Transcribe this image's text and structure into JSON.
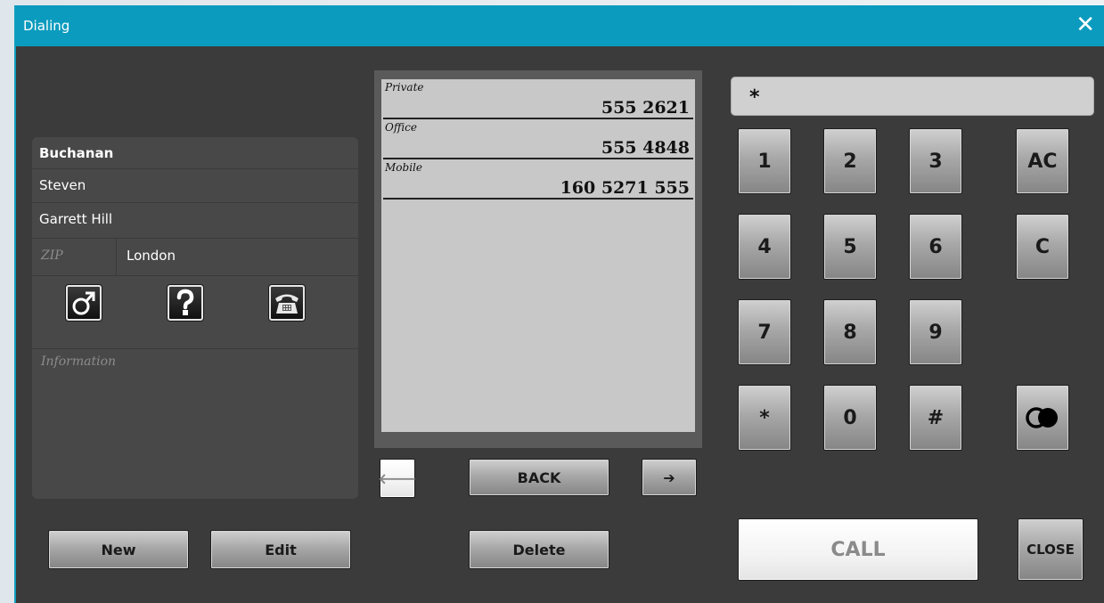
{
  "window": {
    "title": "Dialing",
    "close_glyph": "✕"
  },
  "contact": {
    "last_name": "Buchanan",
    "first_name": "Steven",
    "street": "Garrett Hill",
    "zip_placeholder": "ZIP",
    "city": "London",
    "info_placeholder": "Information",
    "icons": [
      "male-gender-icon",
      "question-icon",
      "telephone-icon"
    ]
  },
  "phone_list": [
    {
      "label": "Private",
      "number": "555 2621"
    },
    {
      "label": "Office",
      "number": "555 4848"
    },
    {
      "label": "Mobile",
      "number": "160 5271 555"
    }
  ],
  "nav": {
    "prev": "🡐",
    "back": "BACK",
    "next": "➔"
  },
  "dialer": {
    "display": "*",
    "keys": [
      "1",
      "2",
      "3",
      "4",
      "5",
      "6",
      "7",
      "8",
      "9",
      "*",
      "0",
      "#"
    ],
    "ac": "AC",
    "c": "C",
    "call": "CALL",
    "close": "CLOSE"
  },
  "buttons": {
    "new": "New",
    "edit": "Edit",
    "delete": "Delete"
  }
}
